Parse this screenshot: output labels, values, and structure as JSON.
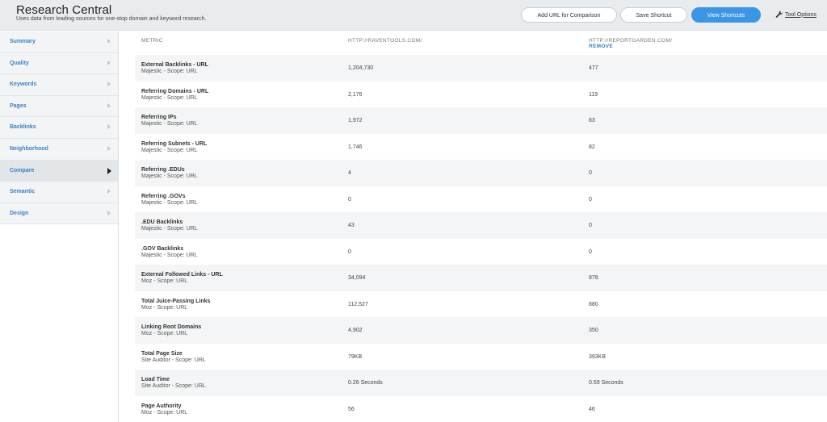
{
  "header": {
    "title": "Research Central",
    "subtitle": "Uses data from leading sources for one-stop domain and keyword research.",
    "add_url_label": "Add URL for Comparison",
    "save_shortcut_label": "Save Shortcut",
    "view_shortcuts_label": "View Shortcuts",
    "tool_options_label": "Tool Options",
    "tool_options_icon": "wrench-icon",
    "accent_color": "#3b96e6"
  },
  "sidebar": {
    "items": [
      {
        "label": "Summary"
      },
      {
        "label": "Quality"
      },
      {
        "label": "Keywords"
      },
      {
        "label": "Pages"
      },
      {
        "label": "Backlinks"
      },
      {
        "label": "Neighborhood"
      },
      {
        "label": "Compare",
        "active": true
      },
      {
        "label": "Semantic"
      },
      {
        "label": "Design"
      }
    ]
  },
  "table": {
    "headers": {
      "metric": "METRIC",
      "col1": "HTTP://RAVENTOOLS.COM/",
      "col2": "HTTP://REPORTGARDEN.COM/",
      "remove": "REMOVE"
    },
    "rows": [
      {
        "metric": "External Backlinks - URL",
        "source": "Majestic - Scope: URL",
        "v1": "1,204,730",
        "v2": "477"
      },
      {
        "metric": "Referring Domains - URL",
        "source": "Majestic - Scope: URL",
        "v1": "2,176",
        "v2": "119"
      },
      {
        "metric": "Referring IPs",
        "source": "Majestic - Scope: URL",
        "v1": "1,972",
        "v2": "83"
      },
      {
        "metric": "Referring Subnets - URL",
        "source": "Majestic - Scope: URL",
        "v1": "1,746",
        "v2": "82"
      },
      {
        "metric": "Referring .EDUs",
        "source": "Majestic - Scope: URL",
        "v1": "4",
        "v2": "0"
      },
      {
        "metric": "Referring .GOVs",
        "source": "Majestic - Scope: URL",
        "v1": "0",
        "v2": "0"
      },
      {
        "metric": ".EDU Backlinks",
        "source": "Majestic - Scope: URL",
        "v1": "43",
        "v2": "0"
      },
      {
        "metric": ".GOV Backlinks",
        "source": "Majestic - Scope: URL",
        "v1": "0",
        "v2": "0"
      },
      {
        "metric": "External Followed Links - URL",
        "source": "Moz - Scope: URL",
        "v1": "34,094",
        "v2": "878"
      },
      {
        "metric": "Total Juice-Passing Links",
        "source": "Moz - Scope: URL",
        "v1": "112,527",
        "v2": "880"
      },
      {
        "metric": "Linking Root Domains",
        "source": "Moz - Scope: URL",
        "v1": "4,902",
        "v2": "350"
      },
      {
        "metric": "Total Page Size",
        "source": "Site Auditor - Scope: URL",
        "v1": "79KB",
        "v2": "393KB"
      },
      {
        "metric": "Load Time",
        "source": "Site Auditor - Scope: URL",
        "v1": "0.26 Seconds",
        "v2": "0.59 Seconds"
      },
      {
        "metric": "Page Authority",
        "source": "Moz - Scope: URL",
        "v1": "56",
        "v2": "46"
      }
    ]
  }
}
